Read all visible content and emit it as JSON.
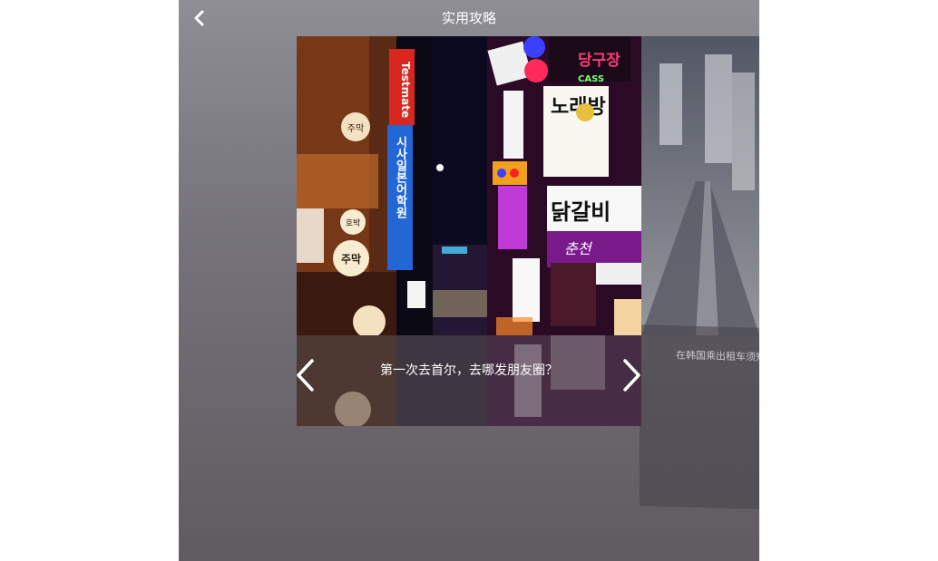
{
  "header": {
    "title": "实用攻略",
    "back_icon": "chevron-left-icon"
  },
  "carousel": {
    "current_caption": "第一次去首尔，去哪发朋友圈？",
    "next_caption": "在韩国乘出租车须知。",
    "prev_icon": "chevron-left-icon",
    "next_icon": "chevron-right-icon"
  },
  "photo": {
    "signs": {
      "testmate": "Testmate",
      "academy": "시사일본어학원",
      "jumak": "주막",
      "norae": "노래방",
      "dakgalbi": "닭갈비",
      "chunchen": "춘천",
      "dangujang": "당구장",
      "cass": "CASS",
      "hopa": "호박"
    }
  },
  "colors": {
    "accent": "#ffffff",
    "panel": "#76737b"
  }
}
